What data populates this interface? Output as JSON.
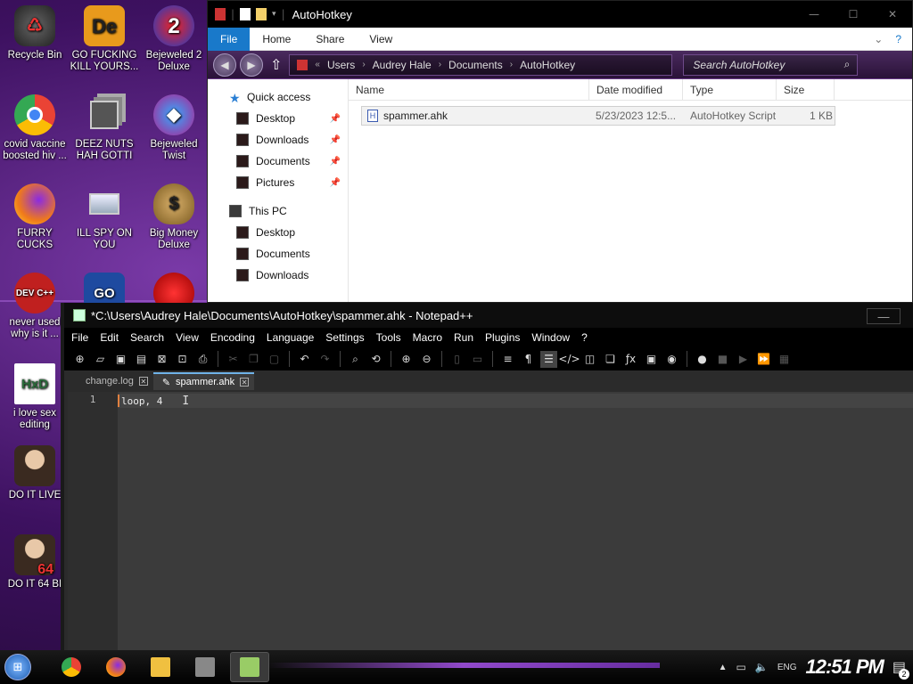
{
  "desktop": {
    "icons": [
      {
        "label": "Recycle Bin",
        "name": "recycle-bin-icon",
        "color": "#3a3a3a"
      },
      {
        "label": "GO FUCKING KILL YOURS...",
        "name": "de-app-icon",
        "color": "#e89a1c",
        "glyph": "De"
      },
      {
        "label": "Bejeweled 2 Deluxe",
        "name": "bejeweled2-icon",
        "color": "#1d3ec8",
        "glyph": "2"
      },
      {
        "label": "covid vaccine boosted hiv ...",
        "name": "chrome-icon",
        "color": "#e33"
      },
      {
        "label": "DEEZ NUTS HAH GOTTI",
        "name": "windows-stack-icon",
        "color": "#888"
      },
      {
        "label": "Bejeweled Twist",
        "name": "bejeweled-twist-icon",
        "color": "#b02090"
      },
      {
        "label": "FURRY CUCKS",
        "name": "firefox-icon",
        "color": "#f07a1a"
      },
      {
        "label": "ILL SPY ON YOU",
        "name": "spy-monitor-icon",
        "color": "#8aa"
      },
      {
        "label": "Big Money Deluxe",
        "name": "money-bag-icon",
        "color": "#b58a3a",
        "glyph": "$"
      },
      {
        "label": "never used why is it ...",
        "name": "devcpp-icon",
        "color": "#c0201f",
        "glyph": "DEV C++"
      },
      {
        "label": "GO",
        "name": "go-icon",
        "color": "#1e4aa0",
        "glyph": "GO"
      },
      {
        "label": "",
        "name": "red-creature-icon",
        "color": "#d01818"
      },
      {
        "label": "i love sex editing",
        "name": "hxd-icon",
        "color": "#fff",
        "glyph": "HxD"
      },
      {
        "label": "DO IT LIVE",
        "name": "portrait-icon",
        "color": "#6a5040"
      },
      {
        "label": "DO IT 64 BI",
        "name": "portrait-64-icon",
        "color": "#6a5040",
        "glyph": "64"
      }
    ]
  },
  "explorer": {
    "title": "AutoHotkey",
    "ribbon_tabs": [
      "File",
      "Home",
      "Share",
      "View"
    ],
    "breadcrumbs": [
      "Users",
      "Audrey Hale",
      "Documents",
      "AutoHotkey"
    ],
    "search_placeholder": "Search AutoHotkey",
    "quick_access_label": "Quick access",
    "quick_access_items": [
      "Desktop",
      "Downloads",
      "Documents",
      "Pictures"
    ],
    "this_pc_label": "This PC",
    "this_pc_items": [
      "Desktop",
      "Documents",
      "Downloads"
    ],
    "columns": [
      "Name",
      "Date modified",
      "Type",
      "Size"
    ],
    "files": [
      {
        "name": "spammer.ahk",
        "date": "5/23/2023 12:5...",
        "type": "AutoHotkey Script",
        "size": "1 KB"
      }
    ]
  },
  "notepad": {
    "title": "*C:\\Users\\Audrey Hale\\Documents\\AutoHotkey\\spammer.ahk - Notepad++",
    "menu": [
      "File",
      "Edit",
      "Search",
      "View",
      "Encoding",
      "Language",
      "Settings",
      "Tools",
      "Macro",
      "Run",
      "Plugins",
      "Window",
      "?"
    ],
    "tabs": [
      {
        "label": "change.log",
        "active": false
      },
      {
        "label": "spammer.ahk",
        "active": true
      }
    ],
    "line_number": "1",
    "code_line": "loop, 4"
  },
  "taskbar": {
    "lang": "ENG",
    "clock": "12:51 PM",
    "notification_count": "2"
  }
}
